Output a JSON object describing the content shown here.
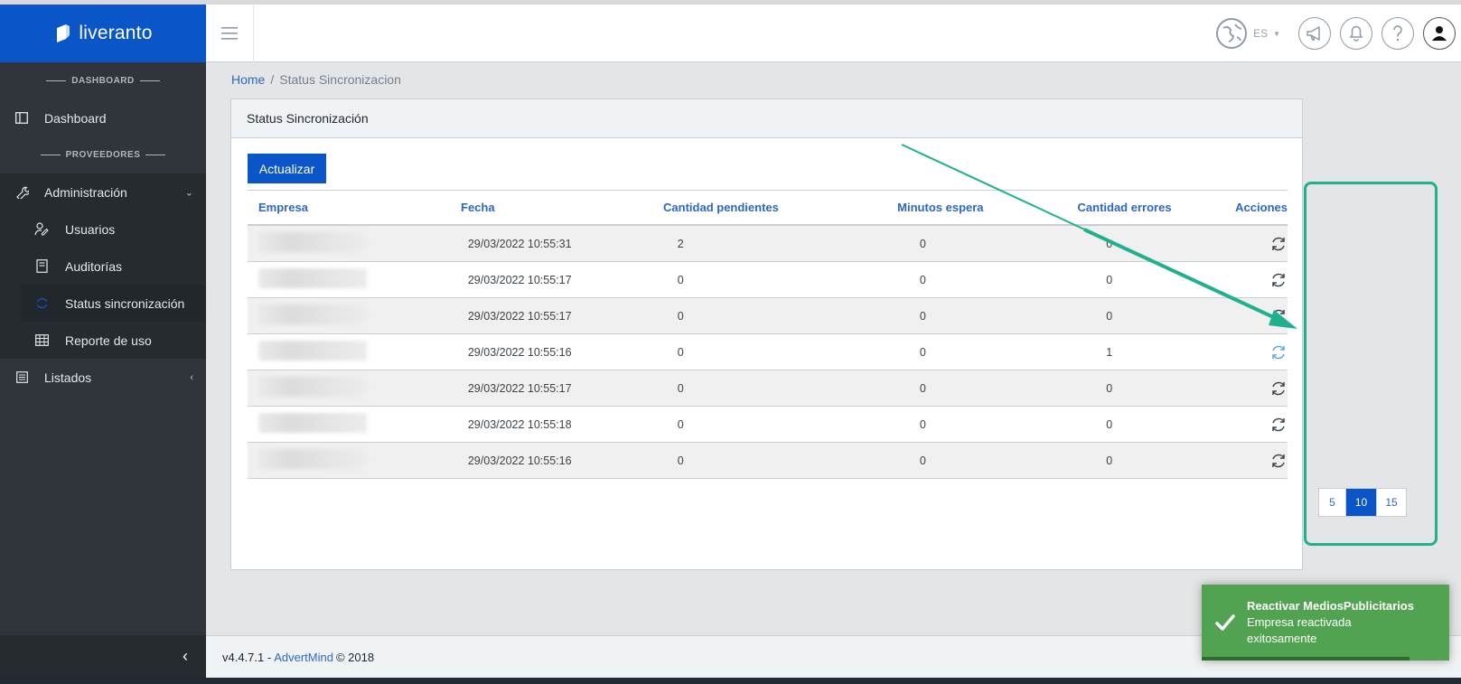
{
  "brand": {
    "name": "liveranto"
  },
  "header": {
    "lang_code": "ES"
  },
  "sidebar": {
    "section_dashboard": "DASHBOARD",
    "section_proveedores": "PROVEEDORES",
    "items": [
      {
        "label": "Dashboard",
        "icon": "layout-icon"
      },
      {
        "label": "Administración",
        "icon": "wrench-icon"
      },
      {
        "label": "Usuarios",
        "icon": "user-edit-icon"
      },
      {
        "label": "Auditorías",
        "icon": "book-icon"
      },
      {
        "label": "Status sincronización",
        "icon": "refresh-icon"
      },
      {
        "label": "Reporte de uso",
        "icon": "grid-icon"
      },
      {
        "label": "Listados",
        "icon": "list-icon"
      }
    ]
  },
  "breadcrumb": {
    "home": "Home",
    "separator": "/",
    "current": "Status Sincronizacion"
  },
  "card": {
    "title": "Status Sincronización",
    "update_button": "Actualizar"
  },
  "table": {
    "headers": [
      "Empresa",
      "Fecha",
      "Cantidad pendientes",
      "Minutos espera",
      "Cantidad errores",
      "Acciones"
    ],
    "rows": [
      {
        "empresa": "",
        "fecha": "29/03/2022 10:55:31",
        "pendientes": "2",
        "minutos": "0",
        "errores": "0"
      },
      {
        "empresa": "",
        "fecha": "29/03/2022 10:55:17",
        "pendientes": "0",
        "minutos": "0",
        "errores": "0"
      },
      {
        "empresa": "",
        "fecha": "29/03/2022 10:55:17",
        "pendientes": "0",
        "minutos": "0",
        "errores": "0"
      },
      {
        "empresa": "",
        "fecha": "29/03/2022 10:55:16",
        "pendientes": "0",
        "minutos": "0",
        "errores": "1"
      },
      {
        "empresa": "",
        "fecha": "29/03/2022 10:55:17",
        "pendientes": "0",
        "minutos": "0",
        "errores": "0"
      },
      {
        "empresa": "",
        "fecha": "29/03/2022 10:55:18",
        "pendientes": "0",
        "minutos": "0",
        "errores": "0"
      },
      {
        "empresa": "",
        "fecha": "29/03/2022 10:55:16",
        "pendientes": "0",
        "minutos": "0",
        "errores": "0"
      }
    ]
  },
  "pagination": {
    "options": [
      "5",
      "10",
      "15"
    ],
    "selected": "10"
  },
  "footer": {
    "version": "v4.4.7.1 -",
    "company": "AdvertMind",
    "copyright": "© 2018"
  },
  "toast": {
    "title": "Reactivar MediosPublicitarios",
    "message": "Empresa reactivada exitosamente"
  },
  "colors": {
    "brand": "#0a56c9",
    "sidebar": "#2f353a",
    "link": "#2f66c6",
    "toast_success": "#51a351",
    "annotation": "#20b08e"
  }
}
